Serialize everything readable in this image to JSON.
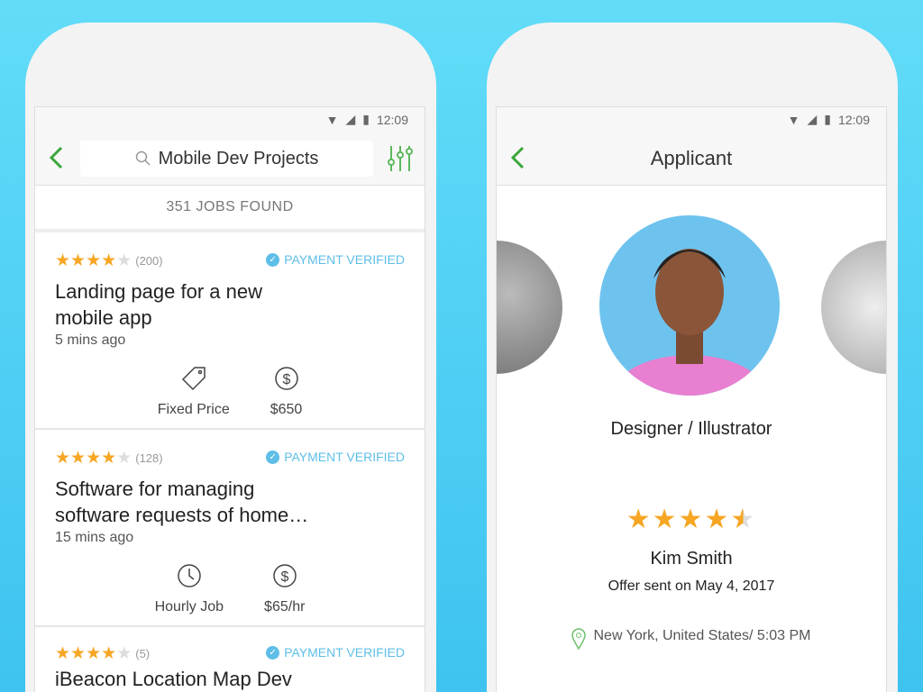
{
  "status": {
    "time": "12:09"
  },
  "left": {
    "search": "Mobile Dev Projects",
    "jobs_found": "351 JOBS FOUND",
    "jobs": [
      {
        "stars": 4,
        "reviews": "(200)",
        "verified": "PAYMENT VERIFIED",
        "title": "Landing page for a new mobile app",
        "ago": "5 mins ago",
        "type": "Fixed Price",
        "type_icon": "price-tag-icon",
        "price": "$650"
      },
      {
        "stars": 4,
        "reviews": "(128)",
        "verified": "PAYMENT VERIFIED",
        "title": "Software for managing software requests of home…",
        "ago": "15 mins ago",
        "type": "Hourly Job",
        "type_icon": "clock-icon",
        "price": "$65/hr"
      },
      {
        "stars": 4,
        "reviews": "(5)",
        "verified": "PAYMENT VERIFIED",
        "title": "iBeacon Location Map Dev",
        "ago": "",
        "type": "",
        "price": ""
      }
    ]
  },
  "right": {
    "title": "Applicant",
    "role": "Designer / Illustrator",
    "rating": 4.5,
    "name": "Kim Smith",
    "offer": "Offer sent on May 4, 2017",
    "location": "New York, United States/ 5:03 PM"
  },
  "colors": {
    "accent": "#3aa63a",
    "verified": "#5ebee8",
    "star": "#f6a623",
    "background": "#4fd0f5"
  }
}
